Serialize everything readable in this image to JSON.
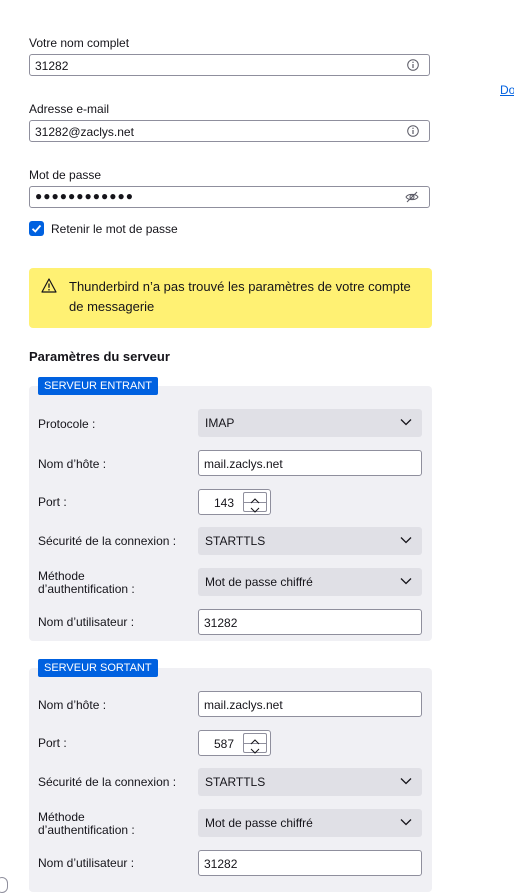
{
  "identity": {
    "name_label": "Votre nom complet",
    "name_value": "31282",
    "email_label": "Adresse e-mail",
    "email_value": "31282@zaclys.net",
    "password_label": "Mot de passe",
    "password_value": "●●●●●●●●●●●●",
    "remember_label": "Retenir le mot de passe",
    "remember_checked": true,
    "side_link": "Do"
  },
  "warning": {
    "text": "Thunderbird n’a pas trouvé les paramètres de votre compte de messagerie",
    "background": "#fff173"
  },
  "server_settings": {
    "title": "Paramètres du serveur",
    "incoming": {
      "badge": "SERVEUR ENTRANT",
      "protocol_label": "Protocole :",
      "protocol_value": "IMAP",
      "hostname_label": "Nom d’hôte :",
      "hostname_value": "mail.zaclys.net",
      "port_label": "Port :",
      "port_value": "143",
      "security_label": "Sécurité de la connexion :",
      "security_value": "STARTTLS",
      "auth_label_line1": "Méthode",
      "auth_label_line2": "d’authentification :",
      "auth_value": "Mot de passe chiffré",
      "username_label": "Nom d’utilisateur :",
      "username_value": "31282"
    },
    "outgoing": {
      "badge": "SERVEUR SORTANT",
      "hostname_label": "Nom d’hôte :",
      "hostname_value": "mail.zaclys.net",
      "port_label": "Port :",
      "port_value": "587",
      "security_label": "Sécurité de la connexion :",
      "security_value": "STARTTLS",
      "auth_label_line1": "Méthode",
      "auth_label_line2": "d’authentification :",
      "auth_value": "Mot de passe chiffré",
      "username_label": "Nom d’utilisateur :",
      "username_value": "31282"
    }
  },
  "colors": {
    "accent": "#0061e0",
    "panel": "#f0f0f4",
    "select": "#e0e0e6"
  }
}
